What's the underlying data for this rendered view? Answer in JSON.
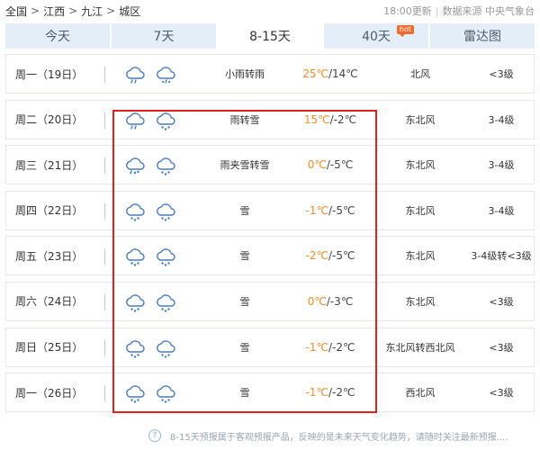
{
  "breadcrumb": {
    "items": [
      "全国",
      "江西",
      "九江",
      "城区"
    ],
    "separator": ">"
  },
  "update": {
    "time": "18:00更新",
    "divider": "|",
    "source": "数据来源 中央气象台"
  },
  "tabs": [
    {
      "label": "今天",
      "active": false
    },
    {
      "label": "7天",
      "active": false
    },
    {
      "label": "8-15天",
      "active": true
    },
    {
      "label": "40天",
      "active": false,
      "badge": "hot"
    },
    {
      "label": "雷达图",
      "active": false
    }
  ],
  "forecast": [
    {
      "date": "周一（19日）",
      "icons": [
        "rain-cloud-icon",
        "snow-rain-cloud-icon"
      ],
      "desc": "小雨转雨",
      "high": "25℃",
      "low": "/14℃",
      "wind": "北风",
      "level": "<3级"
    },
    {
      "date": "周二（20日）",
      "icons": [
        "rain-cloud-icon",
        "snow-cloud-icon"
      ],
      "desc": "雨转雪",
      "high": "15℃",
      "low": "/-2℃",
      "wind": "东北风",
      "level": "3-4级"
    },
    {
      "date": "周三（21日）",
      "icons": [
        "sleet-cloud-icon",
        "snow-cloud-icon"
      ],
      "desc": "雨夹雪转雪",
      "high": "0℃",
      "low": "/-5℃",
      "wind": "东北风",
      "level": "3-4级"
    },
    {
      "date": "周四（22日）",
      "icons": [
        "snow-cloud-icon",
        "snow-cloud-icon"
      ],
      "desc": "雪",
      "high": "-1℃",
      "low": "/-5℃",
      "wind": "东北风",
      "level": "3-4级"
    },
    {
      "date": "周五（23日）",
      "icons": [
        "snow-cloud-icon",
        "snow-cloud-icon"
      ],
      "desc": "雪",
      "high": "-2℃",
      "low": "/-5℃",
      "wind": "东北风",
      "level": "3-4级转<3级"
    },
    {
      "date": "周六（24日）",
      "icons": [
        "snow-cloud-icon",
        "snow-cloud-icon"
      ],
      "desc": "雪",
      "high": "0℃",
      "low": "/-3℃",
      "wind": "东北风",
      "level": "<3级"
    },
    {
      "date": "周日（25日）",
      "icons": [
        "snow-cloud-icon",
        "snow-cloud-icon"
      ],
      "desc": "雪",
      "high": "-1℃",
      "low": "/-2℃",
      "wind": "东北风转西北风",
      "level": "<3级"
    },
    {
      "date": "周一（26日）",
      "icons": [
        "snow-cloud-icon",
        "snow-cloud-icon"
      ],
      "desc": "雪",
      "high": "-1℃",
      "low": "/-2℃",
      "wind": "西北风",
      "level": "<3级"
    }
  ],
  "footer": {
    "help_icon": "?",
    "note": "8-15天预报属于客观预报产品，反映的是未来天气变化趋势，请随时关注最新预报...."
  },
  "colors": {
    "tab_bg": "#e4eef9",
    "high_temp": "#f28b2c",
    "highlight_border": "#e0221d",
    "icon_stroke": "#4a7cb8",
    "hot_badge": "#f06b2e"
  }
}
